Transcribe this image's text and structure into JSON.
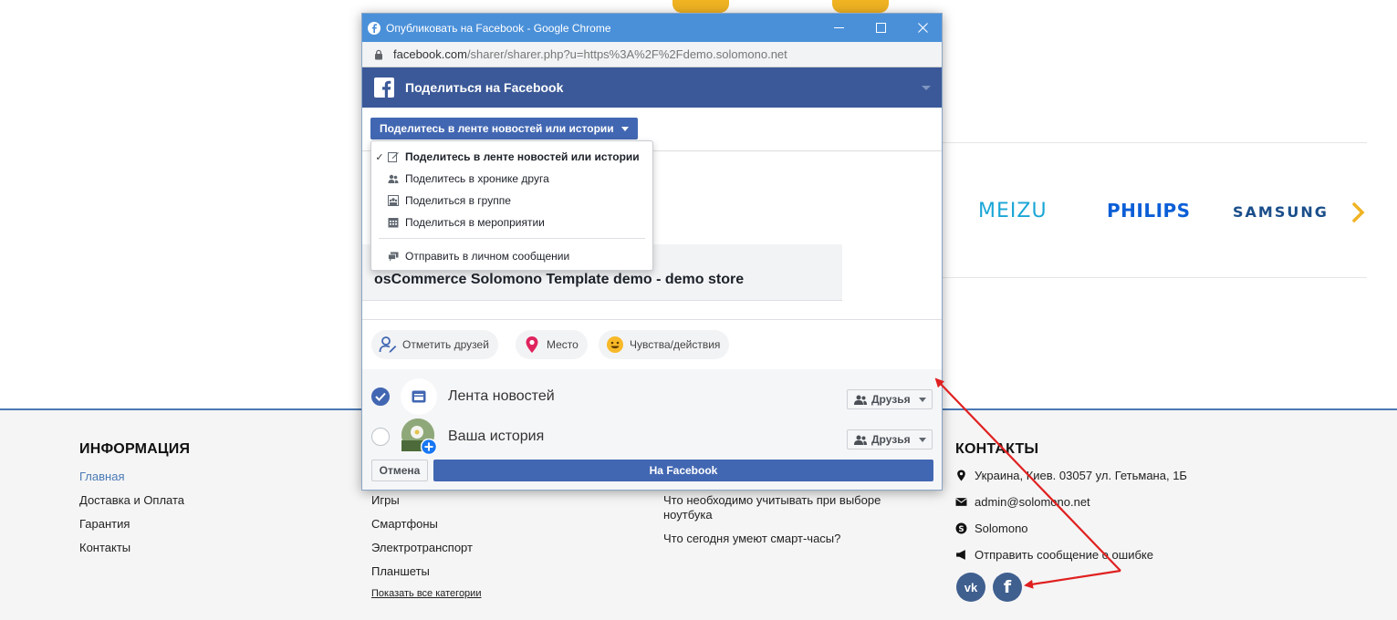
{
  "browser": {
    "window_title": "Опубликовать на Facebook - Google Chrome",
    "url_host": "facebook.com",
    "url_path": "/sharer/sharer.php?u=https%3A%2F%2Fdemo.solomono.net"
  },
  "fb": {
    "header_title": "Поделиться на Facebook",
    "share_target_selected": "Поделитесь в ленте новостей или истории",
    "menu": [
      {
        "label": "Поделитесь в ленте новостей или истории",
        "icon": "edit-icon",
        "checked": true
      },
      {
        "label": "Поделитесь в хронике друга",
        "icon": "friends-icon",
        "checked": false
      },
      {
        "label": "Поделиться в группе",
        "icon": "group-icon",
        "checked": false
      },
      {
        "label": "Поделиться в мероприятии",
        "icon": "calendar-icon",
        "checked": false
      },
      {
        "label": "Отправить в личном сообщении",
        "icon": "message-icon",
        "checked": false
      }
    ],
    "preview_title": "osCommerce Solomono Template demo - demo store",
    "chips": [
      "Отметить друзей",
      "Место",
      "Чувства/действия"
    ],
    "audience": [
      {
        "label": "Лента новостей",
        "privacy": "Друзья",
        "checked": true
      },
      {
        "label": "Ваша история",
        "privacy": "Друзья",
        "checked": false
      }
    ],
    "cancel_label": "Отмена",
    "post_label": "На Facebook"
  },
  "brands": [
    "MEIZU",
    "PHILIPS",
    "SAMSUNG"
  ],
  "footer": {
    "info_heading": "ИНФОРМАЦИЯ",
    "info_links": [
      "Главная",
      "Доставка и Оплата",
      "Гарантия",
      "Контакты"
    ],
    "category_links": [
      "Игры",
      "Смартфоны",
      "Электротранспорт",
      "Планшеты"
    ],
    "show_all_categories": "Показать все категории",
    "articles": [
      "Что необходимо учитывать при выборе",
      "ноутбука",
      "Что сегодня умеют смарт-часы?"
    ],
    "contacts_heading": "КОНТАКТЫ",
    "address": "Украина, Киев. 03057 ул. Гетьмана, 1Б",
    "email": "admin@solomono.net",
    "skype": "Solomono",
    "report_error": "Отправить сообщение о ошибке",
    "social": [
      "vk-icon",
      "facebook-icon"
    ]
  },
  "colors": {
    "fb_blue": "#3b5998",
    "fb_button": "#4267b2",
    "chrome_titlebar": "#4a90d9",
    "annotation_arrow": "#e02020"
  }
}
